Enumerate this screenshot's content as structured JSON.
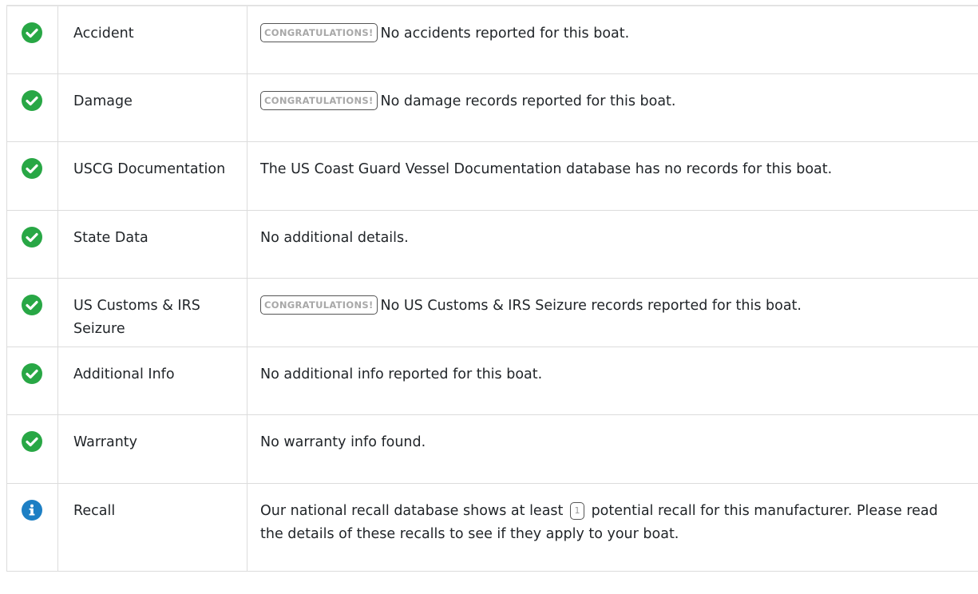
{
  "colors": {
    "success": "#28a745",
    "info": "#1d7fc4",
    "border": "#dcdcdc"
  },
  "rows": [
    {
      "label": "Accident",
      "status_icon": "check-circle-icon",
      "badge": "CONGRATULATIONS!",
      "detail": "No accidents reported for this boat."
    },
    {
      "label": "Damage",
      "status_icon": "check-circle-icon",
      "badge": "CONGRATULATIONS!",
      "detail": "No damage records reported for this boat."
    },
    {
      "label": "USCG Documentation",
      "status_icon": "check-circle-icon",
      "detail": "The US Coast Guard Vessel Documentation database has no records for this boat."
    },
    {
      "label": "State Data",
      "status_icon": "check-circle-icon",
      "detail": "No additional details."
    },
    {
      "label": "US Customs & IRS Seizure",
      "status_icon": "check-circle-icon",
      "badge": "CONGRATULATIONS!",
      "detail": "No US Customs & IRS Seizure records reported for this boat."
    },
    {
      "label": "Additional Info",
      "status_icon": "check-circle-icon",
      "detail": "No additional info reported for this boat."
    },
    {
      "label": "Warranty",
      "status_icon": "check-circle-icon",
      "detail": "No warranty info found."
    },
    {
      "label": "Recall",
      "status_icon": "info-circle-icon",
      "detail_before": "Our national recall database shows at least",
      "recall_count": "1",
      "detail_after": "potential recall for this manufacturer. Please read the details of these recalls to see if they apply to your boat."
    }
  ]
}
